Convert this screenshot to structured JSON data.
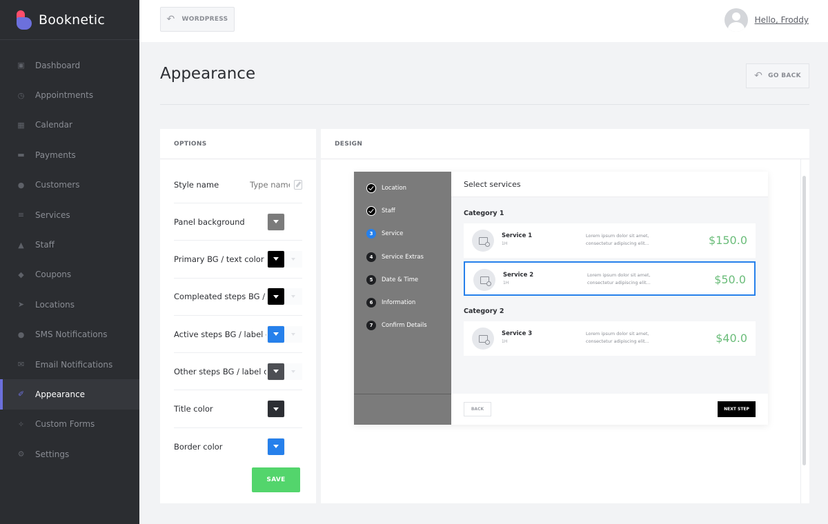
{
  "app": {
    "name": "Booknetic"
  },
  "sidebar": {
    "items": [
      {
        "label": "Dashboard",
        "icon": "dashboard-icon",
        "active": false
      },
      {
        "label": "Appointments",
        "icon": "clock-icon",
        "active": false
      },
      {
        "label": "Calendar",
        "icon": "calendar-icon",
        "active": false
      },
      {
        "label": "Payments",
        "icon": "credit-card-icon",
        "active": false
      },
      {
        "label": "Customers",
        "icon": "users-icon",
        "active": false
      },
      {
        "label": "Services",
        "icon": "list-icon",
        "active": false
      },
      {
        "label": "Staff",
        "icon": "user-icon",
        "active": false
      },
      {
        "label": "Coupons",
        "icon": "tag-icon",
        "active": false
      },
      {
        "label": "Locations",
        "icon": "location-arrow-icon",
        "active": false
      },
      {
        "label": "SMS Notifications",
        "icon": "chat-icon",
        "active": false
      },
      {
        "label": "Email Notifications",
        "icon": "envelope-icon",
        "active": false
      },
      {
        "label": "Appearance",
        "icon": "brush-icon",
        "active": true
      },
      {
        "label": "Custom Forms",
        "icon": "wand-icon",
        "active": false
      },
      {
        "label": "Settings",
        "icon": "gear-icon",
        "active": false
      }
    ]
  },
  "topbar": {
    "wordpress_label": "WORDPRESS",
    "user_greeting": "Hello, Froddy"
  },
  "page": {
    "title": "Appearance",
    "go_back_label": "GO BACK"
  },
  "options": {
    "heading": "OPTIONS",
    "style_name_label": "Style name",
    "style_name_placeholder": "Type name",
    "rows": [
      {
        "label": "Panel background",
        "color": "#7b7b7b",
        "ghost": false
      },
      {
        "label": "Primary BG / text color",
        "color": "#000000",
        "ghost": true
      },
      {
        "label": "Compleated steps BG / label color",
        "color": "#000000",
        "ghost": true
      },
      {
        "label": "Active steps BG / label color",
        "color": "#2680eb",
        "ghost": true
      },
      {
        "label": "Other steps BG / label color",
        "color": "#4d4f54",
        "ghost": true
      },
      {
        "label": "Title color",
        "color": "#2c2e33",
        "ghost": false
      },
      {
        "label": "Border color",
        "color": "#2680eb",
        "ghost": false
      }
    ],
    "save_label": "SAVE"
  },
  "design": {
    "heading": "DESIGN",
    "widget": {
      "steps": [
        {
          "num": "",
          "label": "Location",
          "state": "done"
        },
        {
          "num": "",
          "label": "Staff",
          "state": "done"
        },
        {
          "num": "3",
          "label": "Service",
          "state": "active"
        },
        {
          "num": "4",
          "label": "Service Extras",
          "state": "todo"
        },
        {
          "num": "5",
          "label": "Date & Time",
          "state": "todo"
        },
        {
          "num": "6",
          "label": "Information",
          "state": "todo"
        },
        {
          "num": "7",
          "label": "Confirm Details",
          "state": "todo"
        }
      ],
      "title": "Select services",
      "categories": [
        {
          "name": "Category 1",
          "services": [
            {
              "name": "Service 1",
              "duration": "1H",
              "desc": "Lorem ipsum dolor sit amet, consectetur adipiscing elit...",
              "price": "$150.0",
              "selected": false
            },
            {
              "name": "Service 2",
              "duration": "1H",
              "desc": "Lorem ipsum dolor sit amet, consectetur adipiscing elit...",
              "price": "$50.0",
              "selected": true
            }
          ]
        },
        {
          "name": "Category 2",
          "services": [
            {
              "name": "Service 3",
              "duration": "1H",
              "desc": "Lorem ipsum dolor sit amet, consectetur adipiscing elit...",
              "price": "$40.0",
              "selected": false
            }
          ]
        }
      ],
      "back_label": "BACK",
      "next_label": "NEXT STEP"
    }
  },
  "colors": {
    "accent": "#6c70dc",
    "save": "#53d56c",
    "sidebar_bg": "#2b2d31",
    "price": "#6bbd7a",
    "active_step": "#2680eb"
  }
}
